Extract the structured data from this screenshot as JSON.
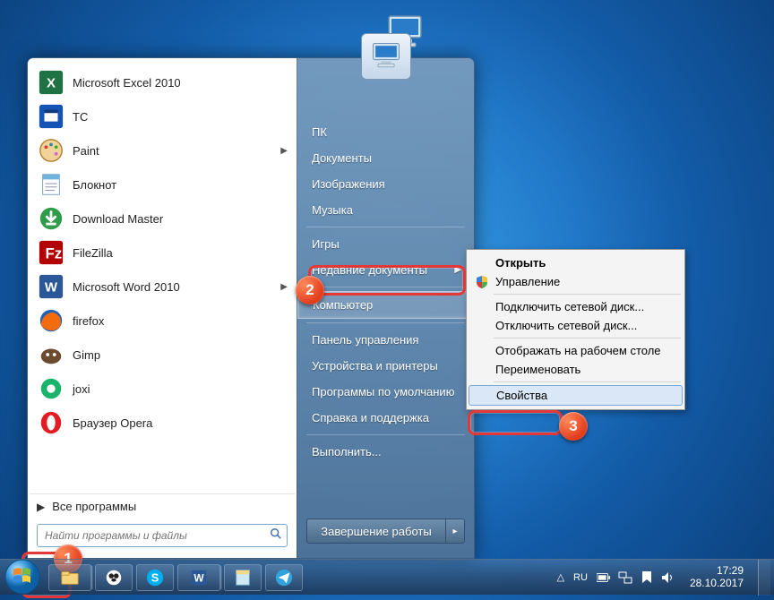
{
  "desktop_icon": {
    "label": ""
  },
  "start_menu": {
    "programs": [
      {
        "icon": "excel",
        "label": "Microsoft Excel 2010"
      },
      {
        "icon": "tc",
        "label": "TC"
      },
      {
        "icon": "paint",
        "label": "Paint"
      },
      {
        "icon": "notepad",
        "label": "Блокнот"
      },
      {
        "icon": "download",
        "label": "Download Master"
      },
      {
        "icon": "filezilla",
        "label": "FileZilla"
      },
      {
        "icon": "word",
        "label": "Microsoft Word 2010"
      },
      {
        "icon": "firefox",
        "label": "firefox"
      },
      {
        "icon": "gimp",
        "label": "Gimp"
      },
      {
        "icon": "joxi",
        "label": "joxi"
      },
      {
        "icon": "opera",
        "label": "Браузер Opera"
      }
    ],
    "all_programs": "Все программы",
    "search_placeholder": "Найти программы и файлы",
    "right_items": [
      {
        "label": "ПК",
        "sep_after": false,
        "arrow": false,
        "highlight": false
      },
      {
        "label": "Документы",
        "sep_after": false,
        "arrow": false,
        "highlight": false
      },
      {
        "label": "Изображения",
        "sep_after": false,
        "arrow": false,
        "highlight": false
      },
      {
        "label": "Музыка",
        "sep_after": true,
        "arrow": false,
        "highlight": false
      },
      {
        "label": "Игры",
        "sep_after": false,
        "arrow": false,
        "highlight": false
      },
      {
        "label": "Недавние документы",
        "sep_after": true,
        "arrow": true,
        "highlight": false
      },
      {
        "label": "Компьютер",
        "sep_after": true,
        "arrow": false,
        "highlight": true
      },
      {
        "label": "Панель управления",
        "sep_after": false,
        "arrow": false,
        "highlight": false
      },
      {
        "label": "Устройства и принтеры",
        "sep_after": false,
        "arrow": false,
        "highlight": false
      },
      {
        "label": "Программы по умолчанию",
        "sep_after": false,
        "arrow": false,
        "highlight": false
      },
      {
        "label": "Справка и поддержка",
        "sep_after": true,
        "arrow": false,
        "highlight": false
      },
      {
        "label": "Выполнить...",
        "sep_after": false,
        "arrow": false,
        "highlight": false
      }
    ],
    "shutdown": "Завершение работы"
  },
  "context_menu": {
    "items": [
      {
        "label": "Открыть",
        "bold": true,
        "icon": ""
      },
      {
        "label": "Управление",
        "bold": false,
        "icon": "shield"
      },
      {
        "sep": true
      },
      {
        "label": "Подключить сетевой диск...",
        "bold": false,
        "icon": ""
      },
      {
        "label": "Отключить сетевой диск...",
        "bold": false,
        "icon": ""
      },
      {
        "sep": true
      },
      {
        "label": "Отображать на рабочем столе",
        "bold": false,
        "icon": ""
      },
      {
        "label": "Переименовать",
        "bold": false,
        "icon": ""
      },
      {
        "sep": true
      },
      {
        "label": "Свойства",
        "bold": false,
        "icon": "",
        "highlight": true
      }
    ]
  },
  "badges": {
    "b1": "1",
    "b2": "2",
    "b3": "3"
  },
  "taskbar": {
    "lang": "RU",
    "time": "17:29",
    "date": "28.10.2017"
  }
}
